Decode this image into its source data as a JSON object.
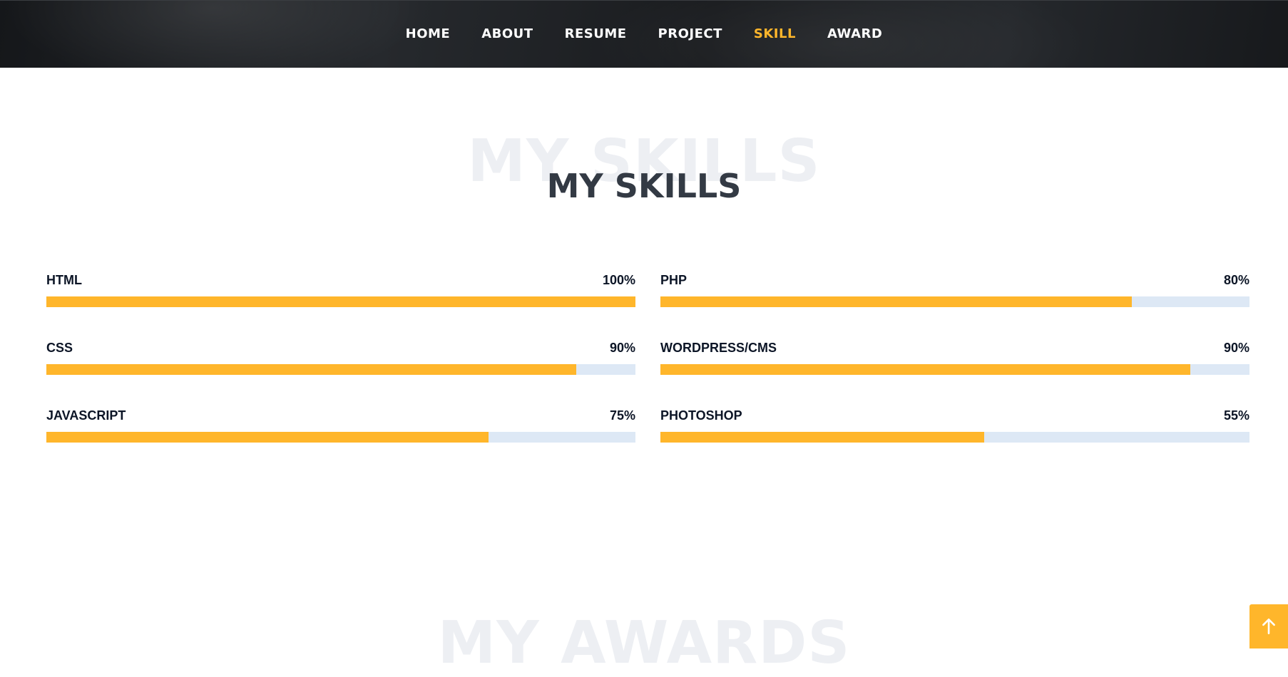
{
  "nav": {
    "items": [
      {
        "label": "HOME",
        "active": false
      },
      {
        "label": "ABOUT",
        "active": false
      },
      {
        "label": "RESUME",
        "active": false
      },
      {
        "label": "PROJECT",
        "active": false
      },
      {
        "label": "SKILL",
        "active": true
      },
      {
        "label": "AWARD",
        "active": false
      }
    ]
  },
  "skills_section": {
    "ghost_title": "MY SKILLS",
    "title": "MY SKILLS",
    "skills": [
      {
        "name": "HTML",
        "percent_label": "100%",
        "value": 100
      },
      {
        "name": "PHP",
        "percent_label": "80%",
        "value": 80
      },
      {
        "name": "CSS",
        "percent_label": "90%",
        "value": 90
      },
      {
        "name": "WORDPRESS/CMS",
        "percent_label": "90%",
        "value": 90
      },
      {
        "name": "JAVASCRIPT",
        "percent_label": "75%",
        "value": 75
      },
      {
        "name": "PHOTOSHOP",
        "percent_label": "55%",
        "value": 55
      }
    ]
  },
  "next_section": {
    "ghost_title": "MY AWARDS"
  },
  "back_to_top": {
    "icon": "arrow-up-icon"
  },
  "colors": {
    "accent": "#ffb62b",
    "bar_track": "#dde8f5",
    "title": "#333a44",
    "ghost": "#edeff3",
    "nav_bg": "#1e2023"
  }
}
